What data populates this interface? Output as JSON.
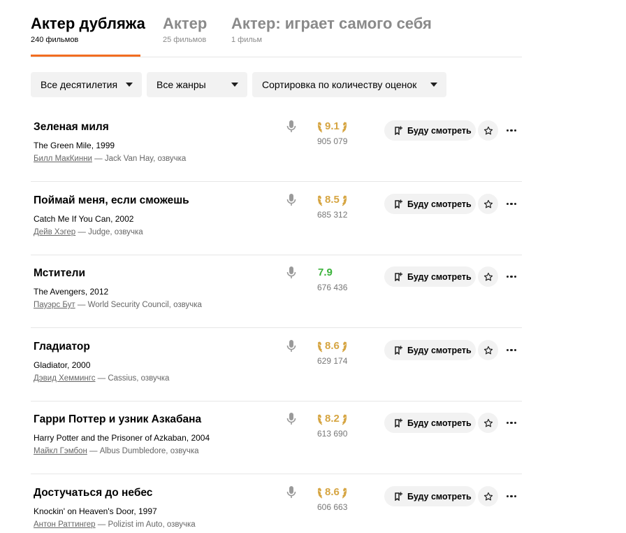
{
  "tabs": [
    {
      "title": "Актер дубляжа",
      "count": "240 фильмов"
    },
    {
      "title": "Актер",
      "count": "25 фильмов"
    },
    {
      "title": "Актер: играет самого себя",
      "count": "1 фильм"
    }
  ],
  "filters": {
    "decades": "Все десятилетия",
    "genres": "Все жанры",
    "sort": "Сортировка по количеству оценок"
  },
  "watch_label": "Буду смотреть",
  "colors": {
    "accent": "#f26d21",
    "rating_gold": "#d6a542",
    "rating_green": "#3bb33b"
  },
  "films": [
    {
      "title": "Зеленая миля",
      "original": "The Green Mile, 1999",
      "person": "Билл МакКинни",
      "role": " — Jack Van Hay, озвучка",
      "rating": "9.1",
      "rating_style": "gold",
      "votes": "905 079"
    },
    {
      "title": "Поймай меня, если сможешь",
      "original": "Catch Me If You Can, 2002",
      "person": "Дейв Хэгер",
      "role": " — Judge, озвучка",
      "rating": "8.5",
      "rating_style": "gold",
      "votes": "685 312"
    },
    {
      "title": "Мстители",
      "original": "The Avengers, 2012",
      "person": "Пауэрс Бут",
      "role": " — World Security Council, озвучка",
      "rating": "7.9",
      "rating_style": "green",
      "votes": "676 436"
    },
    {
      "title": "Гладиатор",
      "original": "Gladiator, 2000",
      "person": "Дэвид Хеммингс",
      "role": " — Cassius, озвучка",
      "rating": "8.6",
      "rating_style": "gold",
      "votes": "629 174"
    },
    {
      "title": "Гарри Поттер и узник Азкабана",
      "original": "Harry Potter and the Prisoner of Azkaban, 2004",
      "person": "Майкл Гэмбон",
      "role": " — Albus Dumbledore, озвучка",
      "rating": "8.2",
      "rating_style": "gold",
      "votes": "613 690"
    },
    {
      "title": "Достучаться до небес",
      "original": "Knockin' on Heaven's Door, 1997",
      "person": "Антон Раттингер",
      "role": " — Polizist im Auto, озвучка",
      "rating": "8.6",
      "rating_style": "gold",
      "votes": "606 663"
    }
  ]
}
